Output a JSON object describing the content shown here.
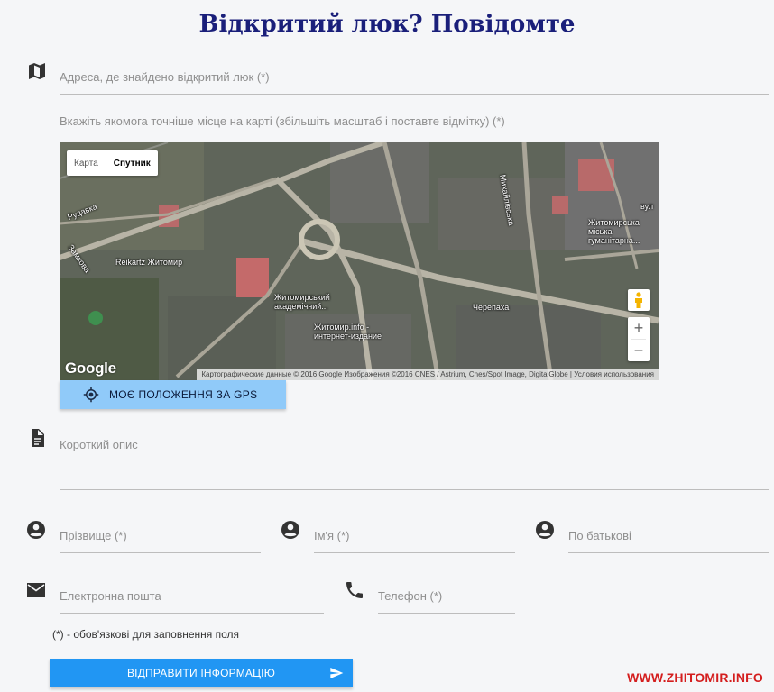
{
  "page": {
    "title": "Відкритий люк? Повідомте"
  },
  "address": {
    "placeholder": "Адреса, де знайдено відкритий люк (*)"
  },
  "map_hint": "Вкажіть якомога точніше місце на карті (збільшіть масштаб і поставте відмітку) (*)",
  "map": {
    "type_map": "Карта",
    "type_satellite": "Спутник",
    "zoom_in": "+",
    "zoom_out": "−",
    "logo": "Google",
    "attribution": "Картографические данные © 2016 Google Изображения ©2016 CNES / Astrium, Cnes/Spot Image, DigitalGlobe  |  Условия использования",
    "labels": {
      "rudavka": "Рудавка",
      "zamkova": "Замкова",
      "reikartz": "Reikartz Житомир",
      "academic": "Житомирський академічний...",
      "zhitomir_info": "Житомир.info - интернет-издание",
      "cherepaha": "Черепаха",
      "mykhailivska": "Михайлівська",
      "humanitarian": "Житомирська міська гуманітарна...",
      "vul": "вул"
    }
  },
  "gps_button": {
    "label": "МОЄ ПОЛОЖЕННЯ ЗА GPS"
  },
  "description": {
    "placeholder": "Короткий опис"
  },
  "surname": {
    "placeholder": "Прізвище (*)"
  },
  "firstname": {
    "placeholder": "Ім'я (*)"
  },
  "patronymic": {
    "placeholder": "По батькові"
  },
  "email": {
    "placeholder": "Електронна пошта"
  },
  "phone": {
    "placeholder": "Телефон (*)"
  },
  "required_note": "(*) - обов'язкові для заповнення поля",
  "submit_button": {
    "label": "ВІДПРАВИТИ ІНФОРМАЦІЮ"
  },
  "watermark": "WWW.ZHITOMIR.INFO",
  "colors": {
    "title": "#1a1f7a",
    "gps_button": "#90caf9",
    "submit_button": "#2196f3",
    "watermark": "#d41e1e"
  },
  "icons": {
    "address": "map-icon",
    "description": "document-icon",
    "person": "account-circle-icon",
    "email": "envelope-icon",
    "phone": "phone-icon",
    "gps": "crosshair-icon",
    "submit": "send-icon"
  }
}
